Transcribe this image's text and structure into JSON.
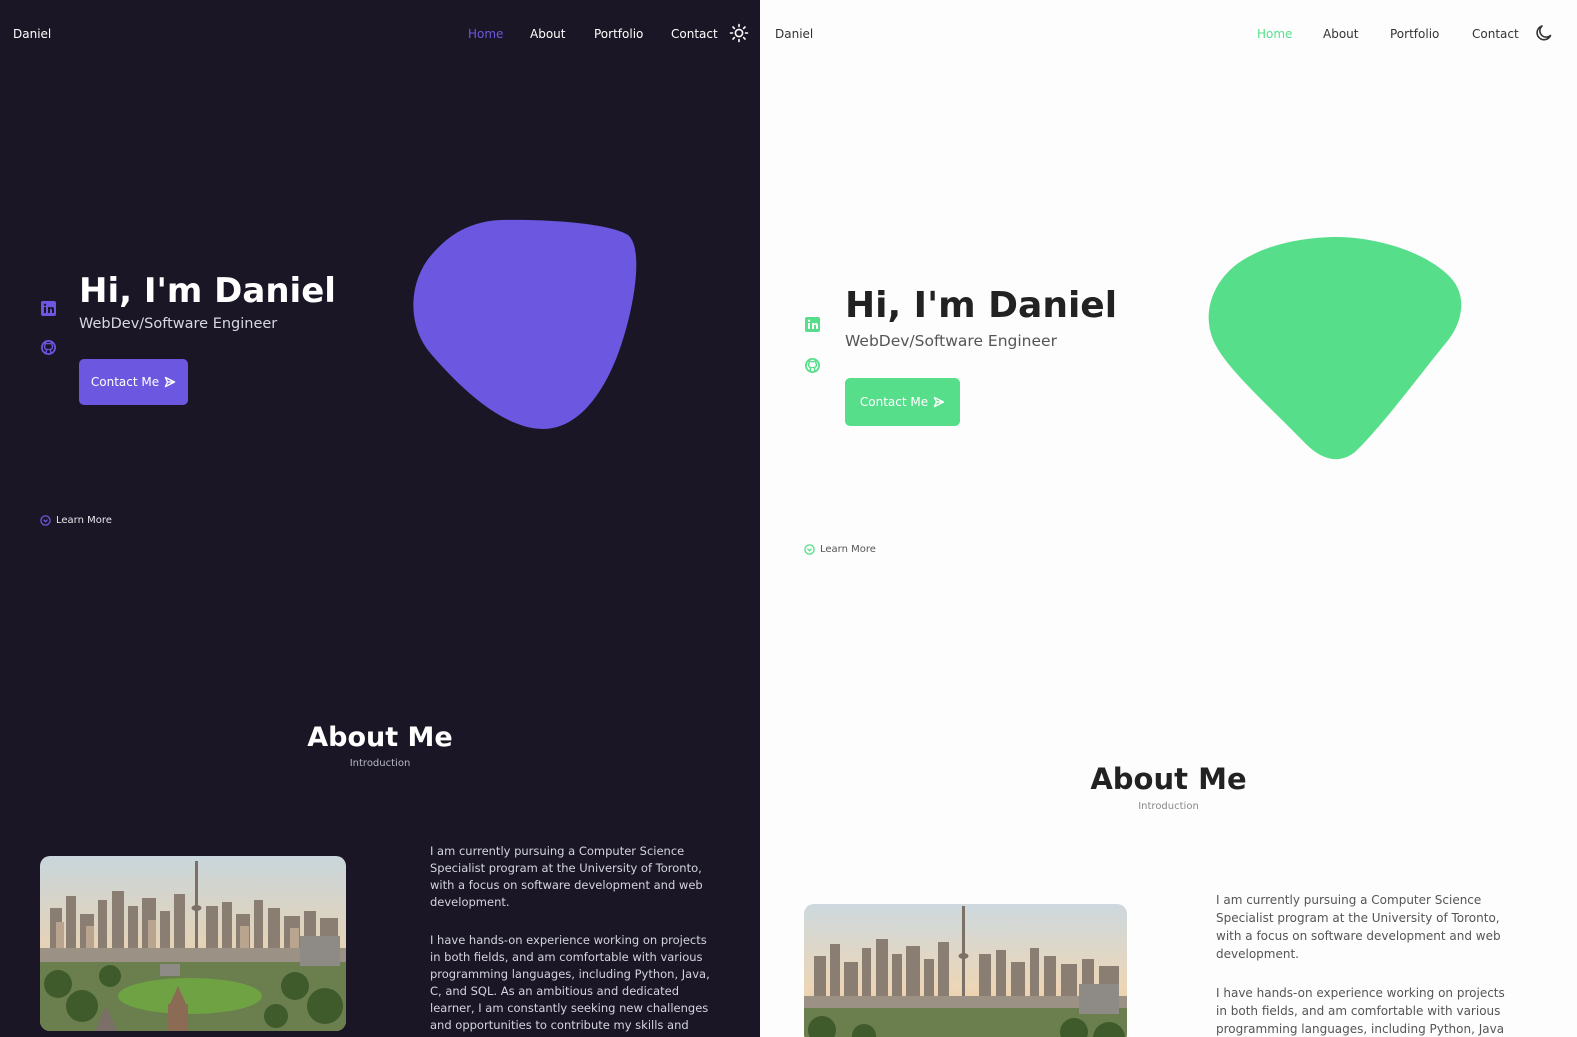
{
  "dark": {
    "brand": "Daniel",
    "nav": {
      "home": "Home",
      "about": "About",
      "portfolio": "Portfolio",
      "contact": "Contact"
    },
    "theme_toggle_icon": "sun-icon",
    "hero": {
      "title": "Hi, I'm Daniel",
      "subtitle": "WebDev/Software Engineer",
      "cta_label": "Contact Me",
      "learn_more": "Learn More"
    },
    "about": {
      "title": "About Me",
      "subtitle": "Introduction",
      "paragraphs": [
        "I am currently pursuing a Computer Science Specialist program at the University of Toronto, with a focus on software development and web development.",
        "I have hands-on experience working on projects in both fields, and am comfortable with various programming languages, including Python, Java, C, and SQL. As an ambitious and dedicated learner, I am constantly seeking new challenges and opportunities to contribute my skills and"
      ]
    },
    "colors": {
      "accent": "#6c57e0",
      "background": "#1a1625",
      "text": "#ffffff"
    }
  },
  "light": {
    "brand": "Daniel",
    "nav": {
      "home": "Home",
      "about": "About",
      "portfolio": "Portfolio",
      "contact": "Contact"
    },
    "theme_toggle_icon": "moon-icon",
    "hero": {
      "title": "Hi, I'm Daniel",
      "subtitle": "WebDev/Software Engineer",
      "cta_label": "Contact Me",
      "learn_more": "Learn More"
    },
    "about": {
      "title": "About Me",
      "subtitle": "Introduction",
      "paragraphs": [
        "I am currently pursuing a Computer Science Specialist program at the University of Toronto, with a focus on software development and web development.",
        "I have hands-on experience working on projects in both fields, and am comfortable with various programming languages, including Python, Java"
      ]
    },
    "colors": {
      "accent": "#57de8b",
      "background": "#fcfdfc",
      "text": "#222222"
    }
  }
}
